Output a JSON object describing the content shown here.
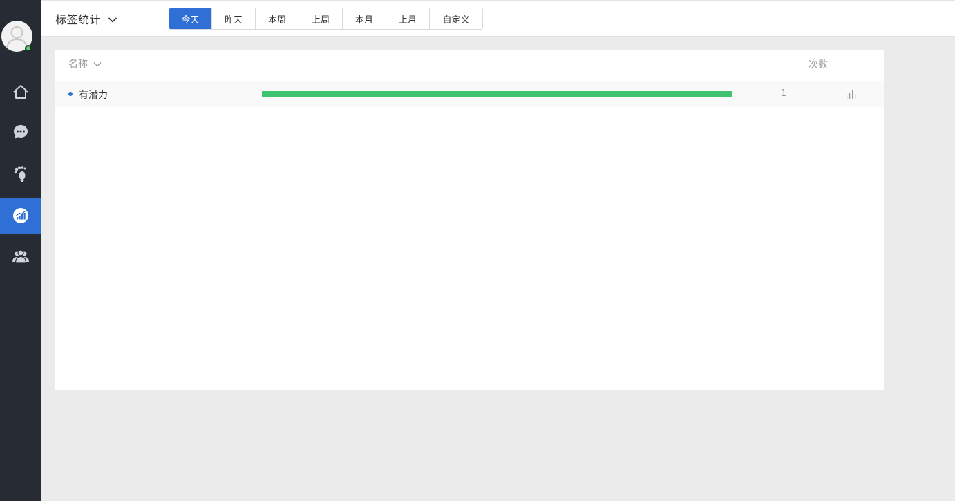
{
  "header": {
    "title": "标签统计",
    "tabs": [
      {
        "label": "今天",
        "active": true
      },
      {
        "label": "昨天",
        "active": false
      },
      {
        "label": "本周",
        "active": false
      },
      {
        "label": "上周",
        "active": false
      },
      {
        "label": "本月",
        "active": false
      },
      {
        "label": "上月",
        "active": false
      },
      {
        "label": "自定义",
        "active": false
      }
    ]
  },
  "sidebar": {
    "avatar_icon": "user-avatar-icon",
    "status": "online",
    "items": [
      {
        "icon": "home-icon",
        "active": false
      },
      {
        "icon": "chat-bubble-icon",
        "active": false
      },
      {
        "icon": "footprint-icon",
        "active": false
      },
      {
        "icon": "statistics-icon",
        "active": true
      },
      {
        "icon": "users-icon",
        "active": false
      }
    ]
  },
  "table": {
    "columns": {
      "name": "名称",
      "count": "次数"
    },
    "rows": [
      {
        "name": "有潜力",
        "count": "1",
        "bar_fraction": 1.0
      }
    ]
  },
  "colors": {
    "sidebar_bg": "#272b33",
    "accent": "#2f6fd6",
    "bar": "#3fc36e",
    "online": "#4cd964"
  }
}
